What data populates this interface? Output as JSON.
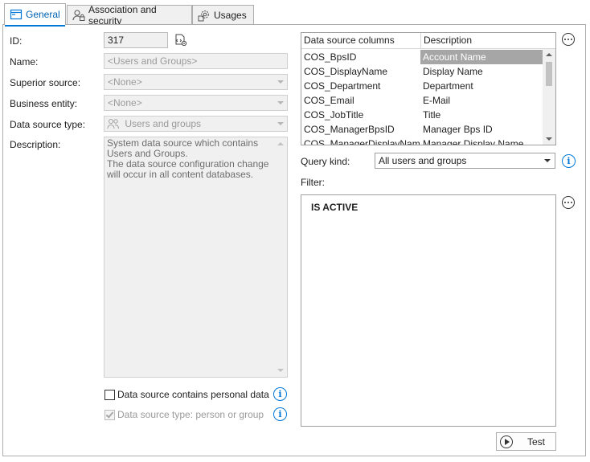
{
  "tabs": [
    {
      "label": "General",
      "icon": "window-icon",
      "active": true
    },
    {
      "label": "Association and security",
      "icon": "user-lock-icon",
      "active": false
    },
    {
      "label": "Usages",
      "icon": "gears-icon",
      "active": false
    }
  ],
  "form": {
    "id_label": "ID:",
    "id_value": "317",
    "name_label": "Name:",
    "name_value": "<Users and Groups>",
    "superior_label": "Superior source:",
    "superior_value": "<None>",
    "business_label": "Business entity:",
    "business_value": "<None>",
    "type_label": "Data source type:",
    "type_value": "Users and groups",
    "description_label": "Description:",
    "description_lines": [
      "System data source which contains Users and Groups.",
      "The data source configuration change will occur in all content databases."
    ],
    "personal_data_label": "Data source contains personal data",
    "person_or_group_label": "Data source type: person or group"
  },
  "grid": {
    "headers": [
      "Data source columns",
      "Description"
    ],
    "rows": [
      {
        "column": "COS_BpsID",
        "description": "Account Name",
        "selected": true
      },
      {
        "column": "COS_DisplayName",
        "description": "Display Name"
      },
      {
        "column": "COS_Department",
        "description": "Department"
      },
      {
        "column": "COS_Email",
        "description": "E-Mail"
      },
      {
        "column": "COS_JobTitle",
        "description": "Title"
      },
      {
        "column": "COS_ManagerBpsID",
        "description": "Manager Bps ID"
      },
      {
        "column": "COS_ManagerDisplayName",
        "description": "Manager Display Name"
      }
    ]
  },
  "query": {
    "label": "Query kind:",
    "value": "All users and groups"
  },
  "filter": {
    "label": "Filter:",
    "value": "IS ACTIVE"
  },
  "test_button": {
    "label": "Test"
  },
  "colors": {
    "accent": "#0078d7",
    "selected_row": "#a6a6a6",
    "disabled_bg": "#f0f0f0"
  }
}
